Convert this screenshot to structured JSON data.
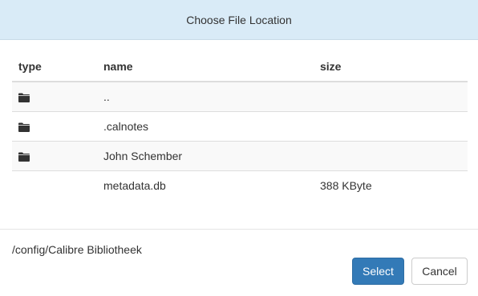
{
  "dialog": {
    "title": "Choose File Location"
  },
  "table": {
    "headers": {
      "type": "type",
      "name": "name",
      "size": "size"
    },
    "rows": [
      {
        "icon": "folder-icon",
        "name": "..",
        "size": ""
      },
      {
        "icon": "folder-icon",
        "name": ".calnotes",
        "size": ""
      },
      {
        "icon": "folder-icon",
        "name": "John Schember",
        "size": ""
      },
      {
        "icon": "",
        "name": "metadata.db",
        "size": "388 KByte"
      }
    ]
  },
  "footer": {
    "current_path": "/config/Calibre Bibliotheek",
    "select_label": "Select",
    "cancel_label": "Cancel"
  },
  "colors": {
    "header_bg": "#d9ebf7",
    "primary": "#337ab7",
    "stripe": "#f9f9f9"
  }
}
